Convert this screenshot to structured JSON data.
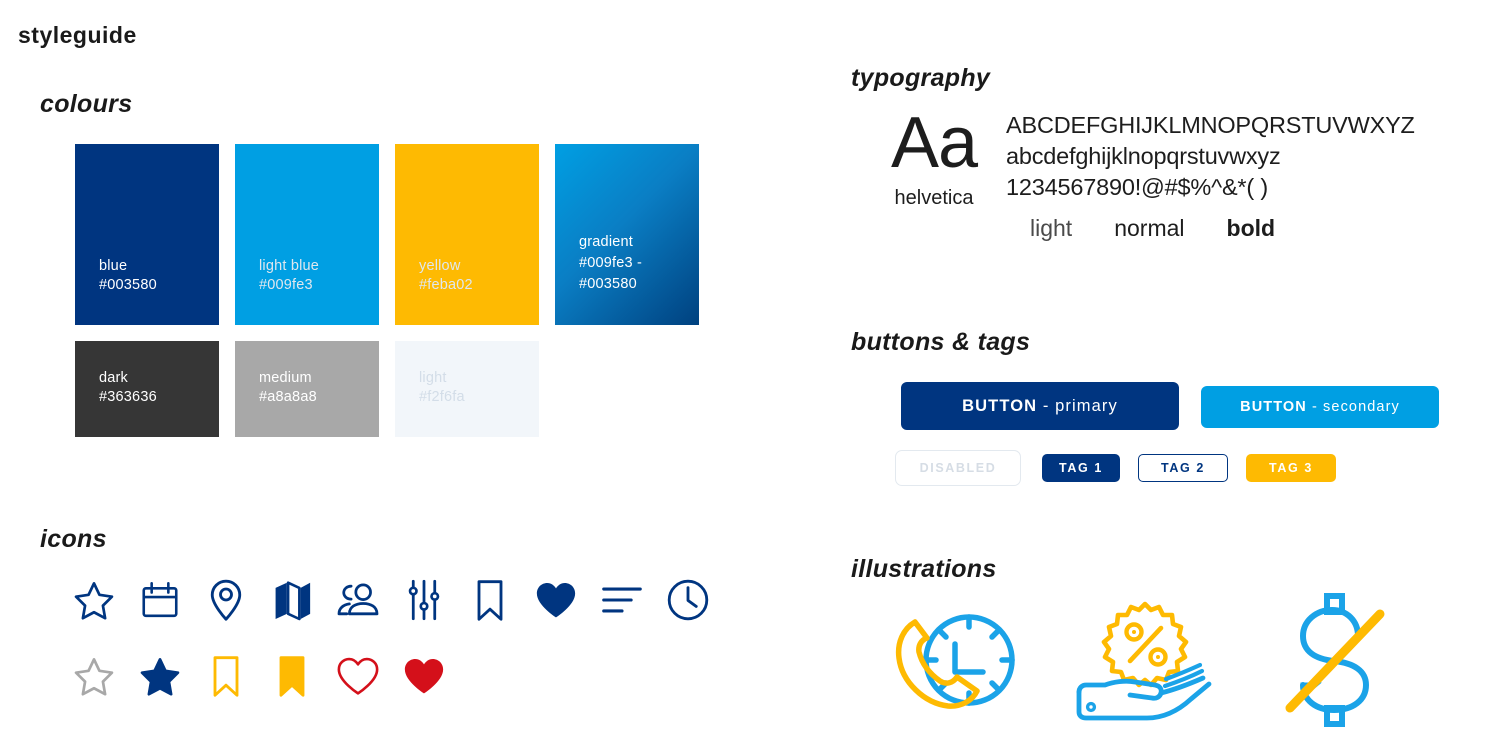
{
  "page": {
    "title": "styleguide"
  },
  "sections": {
    "colours": "colours",
    "icons": "icons",
    "typography": "typography",
    "buttons": "buttons & tags",
    "illustrations": "illustrations"
  },
  "colours": {
    "row1": [
      {
        "name": "blue",
        "hex": "#003580",
        "swatch_color": "#003580",
        "text_style": "light"
      },
      {
        "name": "light blue",
        "hex": "#009fe3",
        "swatch_color": "#009fe3",
        "text_style": "dim"
      },
      {
        "name": "yellow",
        "hex": "#feba02",
        "swatch_color": "#feba02",
        "text_style": "dim"
      },
      {
        "name": "gradient",
        "hex": "#009fe3 -\n#003580",
        "swatch_color": "linear-gradient(135deg,#009fe3 0%,#0a7ec4 45%,#00417f 100%)",
        "text_style": "light"
      }
    ],
    "row2": [
      {
        "name": "dark",
        "hex": "#363636",
        "swatch_color": "#363636",
        "text_style": "light"
      },
      {
        "name": "medium",
        "hex": "#a8a8a8",
        "swatch_color": "#a8a8a8",
        "text_style": "light"
      },
      {
        "name": "light",
        "hex": "#f2f6fa",
        "swatch_color": "#f2f6fa",
        "text_style": "faint"
      }
    ]
  },
  "typography": {
    "sample_glyph": "Aa",
    "font_name": "helvetica",
    "uppercase": "ABCDEFGHIJKLMNOPQRSTUVWXYZ",
    "lowercase": "abcdefghijklnopqrstuvwxyz",
    "numerals": "1234567890!@#$%^&*( )",
    "weights": {
      "light": "light",
      "normal": "normal",
      "bold": "bold"
    }
  },
  "buttons": {
    "primary": {
      "label_bold": "BUTTON",
      "label_rest": " - primary",
      "bg": "#003580"
    },
    "secondary": {
      "label_bold": "BUTTON",
      "label_rest": " - secondary",
      "bg": "#009fe3"
    },
    "tags": [
      {
        "label": "DISABLED",
        "state": "disabled"
      },
      {
        "label": "TAG 1",
        "state": "filled-blue"
      },
      {
        "label": "TAG 2",
        "state": "outline-blue"
      },
      {
        "label": "TAG 3",
        "state": "filled-yellow"
      }
    ]
  },
  "icons": {
    "color": "#003580",
    "row1": [
      "star-outline-icon",
      "calendar-icon",
      "location-pin-icon",
      "map-icon",
      "people-icon",
      "sliders-icon",
      "bookmark-outline-icon",
      "heart-filled-icon",
      "sort-list-icon",
      "clock-icon"
    ],
    "row2": [
      {
        "name": "star-outline-grey-icon",
        "color": "#a8a8a8"
      },
      {
        "name": "star-filled-blue-icon",
        "color": "#003580"
      },
      {
        "name": "bookmark-outline-yellow-icon",
        "color": "#feba02"
      },
      {
        "name": "bookmark-filled-yellow-icon",
        "color": "#feba02"
      },
      {
        "name": "heart-outline-red-icon",
        "color": "#d4101a"
      },
      {
        "name": "heart-filled-red-icon",
        "color": "#d4101a"
      }
    ]
  },
  "illustrations": [
    {
      "name": "phone-clock-globe-illustration",
      "colors": [
        "#feba02",
        "#1ba3e8"
      ]
    },
    {
      "name": "hand-discount-badge-illustration",
      "colors": [
        "#feba02",
        "#1ba3e8"
      ]
    },
    {
      "name": "no-dollar-illustration",
      "colors": [
        "#1ba3e8",
        "#feba02"
      ]
    }
  ]
}
